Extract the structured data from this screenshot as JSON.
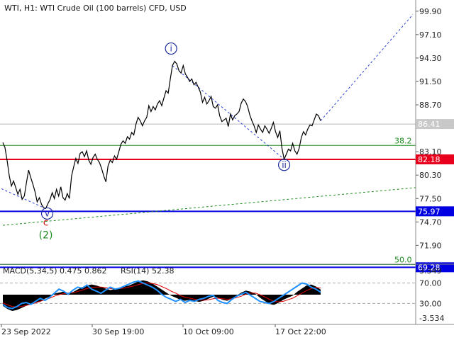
{
  "chart_data": {
    "type": "line",
    "title": "WTI, H1:  WTI Crude Oil (100 barrels) CFD, USD",
    "price_axis": {
      "ylim": [
        69.9,
        100.9
      ],
      "ticks": [
        "99.90",
        "97.10",
        "94.30",
        "91.50",
        "88.70",
        "86.41",
        "83.10",
        "80.30",
        "77.50",
        "74.70",
        "71.90"
      ]
    },
    "time_axis": {
      "labels": [
        "23 Sep 2022",
        "30 Sep 19:00",
        "10 Oct 09:00",
        "17 Oct 22:00"
      ]
    },
    "current_price": {
      "value": 86.41,
      "label": "86.41"
    },
    "horizontal_levels": [
      {
        "value": 82.18,
        "label": "82.18",
        "color": "#e8001c"
      },
      {
        "value": 75.97,
        "label": "75.97",
        "color": "#0000e0"
      },
      {
        "value": 69.28,
        "label": "69.28",
        "color": "#0000e0"
      }
    ],
    "fibonacci_levels": [
      {
        "value": 83.85,
        "label": "38.2",
        "color": "#1e8c1e"
      },
      {
        "value": 69.6,
        "label": "50.0",
        "color": "#1e8c1e"
      }
    ],
    "wave_labels": [
      {
        "text": "i",
        "color": "#1f2f9f",
        "circled": true
      },
      {
        "text": "ii",
        "color": "#1f2f9f",
        "circled": true
      },
      {
        "text": "v",
        "color": "#1f2f9f",
        "circled": true
      },
      {
        "text": "c",
        "color": "#d02020",
        "circled": false
      },
      {
        "text": "(2)",
        "color": "#1e8c1e",
        "circled": false
      }
    ],
    "price_series": [
      84.2,
      83.6,
      82.0,
      80.2,
      79.0,
      79.6,
      78.8,
      78.0,
      78.6,
      77.4,
      77.8,
      79.4,
      80.9,
      80.0,
      79.2,
      78.3,
      77.1,
      77.6,
      76.8,
      76.4,
      76.3,
      76.9,
      77.4,
      78.2,
      77.5,
      78.6,
      77.8,
      78.9,
      77.6,
      77.3,
      78.1,
      77.5,
      80.2,
      81.3,
      82.3,
      81.7,
      82.9,
      83.1,
      82.5,
      83.2,
      82.1,
      81.6,
      82.4,
      82.8,
      82.2,
      81.8,
      81.1,
      80.2,
      79.5,
      81.4,
      82.1,
      81.8,
      82.6,
      82.2,
      83.1,
      84.0,
      84.4,
      84.1,
      84.9,
      84.6,
      85.4,
      85.1,
      86.4,
      87.2,
      86.8,
      86.2,
      86.8,
      87.2,
      88.6,
      87.9,
      88.5,
      88.1,
      88.8,
      89.2,
      88.6,
      89.5,
      90.4,
      90.1,
      91.8,
      93.4,
      93.9,
      93.6,
      92.8,
      92.5,
      93.4,
      92.4,
      92.0,
      91.5,
      91.8,
      91.1,
      91.4,
      90.8,
      90.2,
      89.0,
      89.6,
      88.8,
      89.2,
      89.7,
      88.5,
      88.3,
      88.7,
      87.4,
      86.7,
      86.9,
      87.1,
      86.1,
      87.6,
      86.9,
      87.4,
      87.6,
      87.9,
      88.9,
      89.4,
      89.1,
      88.5,
      87.5,
      86.8,
      86.2,
      85.4,
      86.3,
      85.8,
      85.4,
      86.2,
      85.8,
      85.3,
      85.9,
      86.6,
      85.5,
      84.8,
      85.6,
      83.5,
      82.2,
      82.8,
      83.4,
      83.2,
      84.1,
      83.2,
      82.8,
      83.5,
      84.8,
      85.5,
      85.1,
      85.8,
      86.3,
      86.2,
      86.9,
      87.6,
      87.4,
      86.8
    ],
    "macd": {
      "label": "MACD(5,34,5) 0.475 0.862",
      "ticks": [
        "3.349",
        "-3.534"
      ],
      "histogram": [
        -2.2,
        -2.8,
        -3.2,
        -3.0,
        -2.6,
        -2.2,
        -1.9,
        -1.6,
        -1.4,
        -0.8,
        -0.4,
        0.2,
        0.4,
        0.6,
        0.3,
        0.5,
        1.0,
        1.5,
        1.8,
        2.0,
        1.8,
        1.5,
        1.2,
        0.9,
        1.1,
        1.4,
        1.6,
        1.8,
        2.2,
        2.6,
        2.8,
        2.6,
        2.2,
        1.6,
        1.0,
        0.4,
        -0.2,
        -0.6,
        -1.0,
        -1.2,
        -1.0,
        -1.2,
        -1.4,
        -1.2,
        -0.8,
        -0.4,
        -0.6,
        -1.0,
        -1.2,
        -0.8,
        -0.2,
        0.4,
        0.8,
        0.6,
        0.2,
        -0.6,
        -1.2,
        -1.8,
        -2.0,
        -1.6,
        -1.0,
        -0.6,
        -0.2,
        0.6,
        1.2,
        1.8,
        2.0,
        1.6,
        1.0
      ],
      "signal": [
        -1.6,
        -2.0,
        -2.3,
        -2.4,
        -2.3,
        -2.1,
        -1.9,
        -1.6,
        -1.3,
        -1.0,
        -0.7,
        -0.3,
        0.0,
        0.2,
        0.3,
        0.4,
        0.6,
        0.9,
        1.2,
        1.4,
        1.5,
        1.5,
        1.4,
        1.2,
        1.1,
        1.2,
        1.3,
        1.5,
        1.7,
        2.0,
        2.2,
        2.3,
        2.2,
        2.0,
        1.6,
        1.2,
        0.7,
        0.3,
        -0.2,
        -0.5,
        -0.7,
        -0.9,
        -1.0,
        -1.1,
        -1.0,
        -0.8,
        -0.7,
        -0.8,
        -0.9,
        -0.8,
        -0.6,
        -0.3,
        0.1,
        0.3,
        0.3,
        0.0,
        -0.4,
        -0.9,
        -1.3,
        -1.4,
        -1.3,
        -1.0,
        -0.7,
        -0.2,
        0.3,
        0.8,
        1.2,
        1.4,
        1.3
      ]
    },
    "rsi": {
      "label": "RSI(14) 52.38",
      "levels": [
        "70.00",
        "30.00"
      ],
      "values": [
        28,
        22,
        20,
        24,
        30,
        32,
        28,
        34,
        40,
        36,
        42,
        50,
        58,
        54,
        48,
        56,
        62,
        60,
        66,
        58,
        54,
        50,
        56,
        62,
        58,
        60,
        64,
        68,
        72,
        74,
        70,
        66,
        62,
        56,
        48,
        42,
        38,
        34,
        38,
        32,
        36,
        34,
        38,
        40,
        44,
        46,
        36,
        32,
        30,
        38,
        44,
        48,
        52,
        46,
        40,
        34,
        32,
        30,
        34,
        40,
        46,
        52,
        58,
        64,
        70,
        68,
        62,
        58,
        52
      ]
    }
  }
}
